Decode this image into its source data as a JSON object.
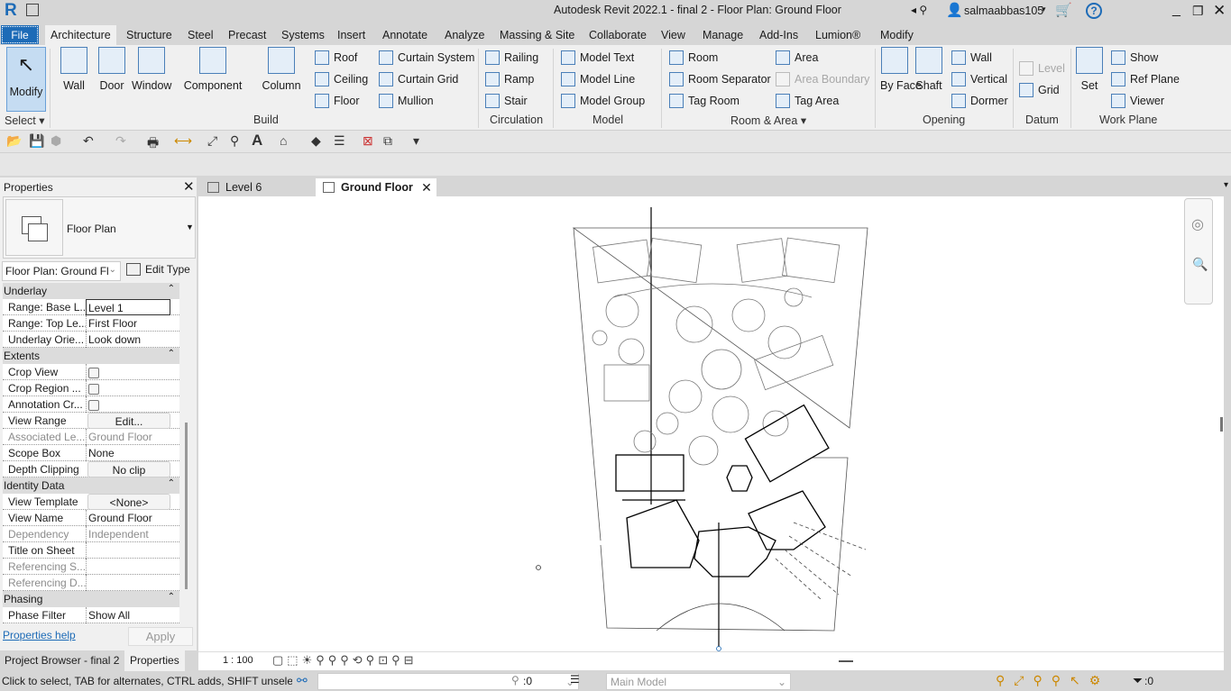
{
  "app": {
    "title": "Autodesk Revit 2022.1 - final 2 - Floor Plan: Ground Floor",
    "user": "salmaabbas105",
    "logo": "R"
  },
  "tabs": [
    "File",
    "Architecture",
    "Structure",
    "Steel",
    "Precast",
    "Systems",
    "Insert",
    "Annotate",
    "Analyze",
    "Massing & Site",
    "Collaborate",
    "View",
    "Manage",
    "Add-Ins",
    "Lumion®",
    "Modify"
  ],
  "ribbon": {
    "items": [
      {
        "label": "Modify",
        "icon": "cursor-arrow-icon"
      },
      {
        "label": "Wall",
        "icon": "wall-icon"
      },
      {
        "label": "Door",
        "icon": "door-icon"
      },
      {
        "label": "Window",
        "icon": "window-icon"
      },
      {
        "label": "Component",
        "icon": "component-icon"
      },
      {
        "label": "Column",
        "icon": "column-icon"
      },
      {
        "label": "Roof",
        "icon": "roof-icon"
      },
      {
        "label": "Ceiling",
        "icon": "ceiling-icon"
      },
      {
        "label": "Floor",
        "icon": "floor-icon"
      },
      {
        "label": "Curtain System",
        "icon": "curtain-system-icon"
      },
      {
        "label": "Curtain Grid",
        "icon": "curtain-grid-icon"
      },
      {
        "label": "Mullion",
        "icon": "mullion-icon"
      },
      {
        "label": "Railing",
        "icon": "railing-icon"
      },
      {
        "label": "Ramp",
        "icon": "ramp-icon"
      },
      {
        "label": "Stair",
        "icon": "stair-icon"
      },
      {
        "label": "Model Text",
        "icon": "model-text-icon"
      },
      {
        "label": "Model Line",
        "icon": "model-line-icon"
      },
      {
        "label": "Model Group",
        "icon": "model-group-icon"
      },
      {
        "label": "Room",
        "icon": "room-icon"
      },
      {
        "label": "Room Separator",
        "icon": "room-separator-icon"
      },
      {
        "label": "Tag Room",
        "icon": "tag-room-icon"
      },
      {
        "label": "Area",
        "icon": "area-icon"
      },
      {
        "label": "Area Boundary",
        "icon": "area-boundary-icon",
        "disabled": true
      },
      {
        "label": "Tag Area",
        "icon": "tag-area-icon"
      },
      {
        "label": "By Face",
        "icon": "by-face-icon"
      },
      {
        "label": "Shaft",
        "icon": "shaft-icon"
      },
      {
        "label": "Wall",
        "icon": "wall-opening-icon"
      },
      {
        "label": "Vertical",
        "icon": "vertical-opening-icon"
      },
      {
        "label": "Dormer",
        "icon": "dormer-icon"
      },
      {
        "label": "Level",
        "icon": "level-icon",
        "disabled": true
      },
      {
        "label": "Grid",
        "icon": "grid-icon"
      },
      {
        "label": "Set",
        "icon": "set-workplane-icon"
      },
      {
        "label": "Show",
        "icon": "show-workplane-icon"
      },
      {
        "label": "Ref Plane",
        "icon": "ref-plane-icon"
      },
      {
        "label": "Viewer",
        "icon": "viewer-icon"
      }
    ],
    "panels": [
      "Select ▾",
      "Build",
      "Circulation",
      "Model",
      "Room & Area ▾",
      "Opening",
      "Datum",
      "Work Plane"
    ]
  },
  "properties": {
    "title": "Properties",
    "type_name": "Floor Plan",
    "instance_selector": "Floor Plan: Ground Fl",
    "edit_type": "Edit Type",
    "rows": [
      {
        "h": "Underlay"
      },
      {
        "k": "Range: Base L...",
        "v": "Level 1",
        "style": "box"
      },
      {
        "k": "Range: Top Le...",
        "v": "First Floor"
      },
      {
        "k": "Underlay Orie...",
        "v": "Look down"
      },
      {
        "h": "Extents"
      },
      {
        "k": "Crop View",
        "check": false
      },
      {
        "k": "Crop Region ...",
        "check": false
      },
      {
        "k": "Annotation Cr...",
        "check": false
      },
      {
        "k": "View Range",
        "v": "Edit...",
        "style": "btn"
      },
      {
        "k": "Associated Le...",
        "v": "Ground Floor",
        "grey": true
      },
      {
        "k": "Scope Box",
        "v": "None"
      },
      {
        "k": "Depth Clipping",
        "v": "No clip",
        "style": "btn"
      },
      {
        "h": "Identity Data"
      },
      {
        "k": "View Template",
        "v": "<None>",
        "style": "btn"
      },
      {
        "k": "View Name",
        "v": "Ground Floor"
      },
      {
        "k": "Dependency",
        "v": "Independent",
        "grey": true
      },
      {
        "k": "Title on Sheet",
        "v": ""
      },
      {
        "k": "Referencing S...",
        "v": "",
        "grey": true
      },
      {
        "k": "Referencing D...",
        "v": "",
        "grey": true
      },
      {
        "h": "Phasing"
      },
      {
        "k": "Phase Filter",
        "v": "Show All"
      }
    ],
    "help": "Properties help",
    "apply": "Apply"
  },
  "bottom_tabs": [
    "Project Browser - final 2",
    "Properties"
  ],
  "view_tabs": [
    {
      "label": "Level 6",
      "active": false
    },
    {
      "label": "Ground Floor",
      "active": true
    }
  ],
  "viewbar": {
    "scale": "1 : 100"
  },
  "status": {
    "hint": "Click to select, TAB for alternates, CTRL adds, SHIFT unselects.",
    "workset_count": ":0",
    "model": "Main Model",
    "filter_count": ":0"
  },
  "colors": {
    "accent": "#1d6bb7",
    "modify_highlight": "#c5dcf2"
  }
}
